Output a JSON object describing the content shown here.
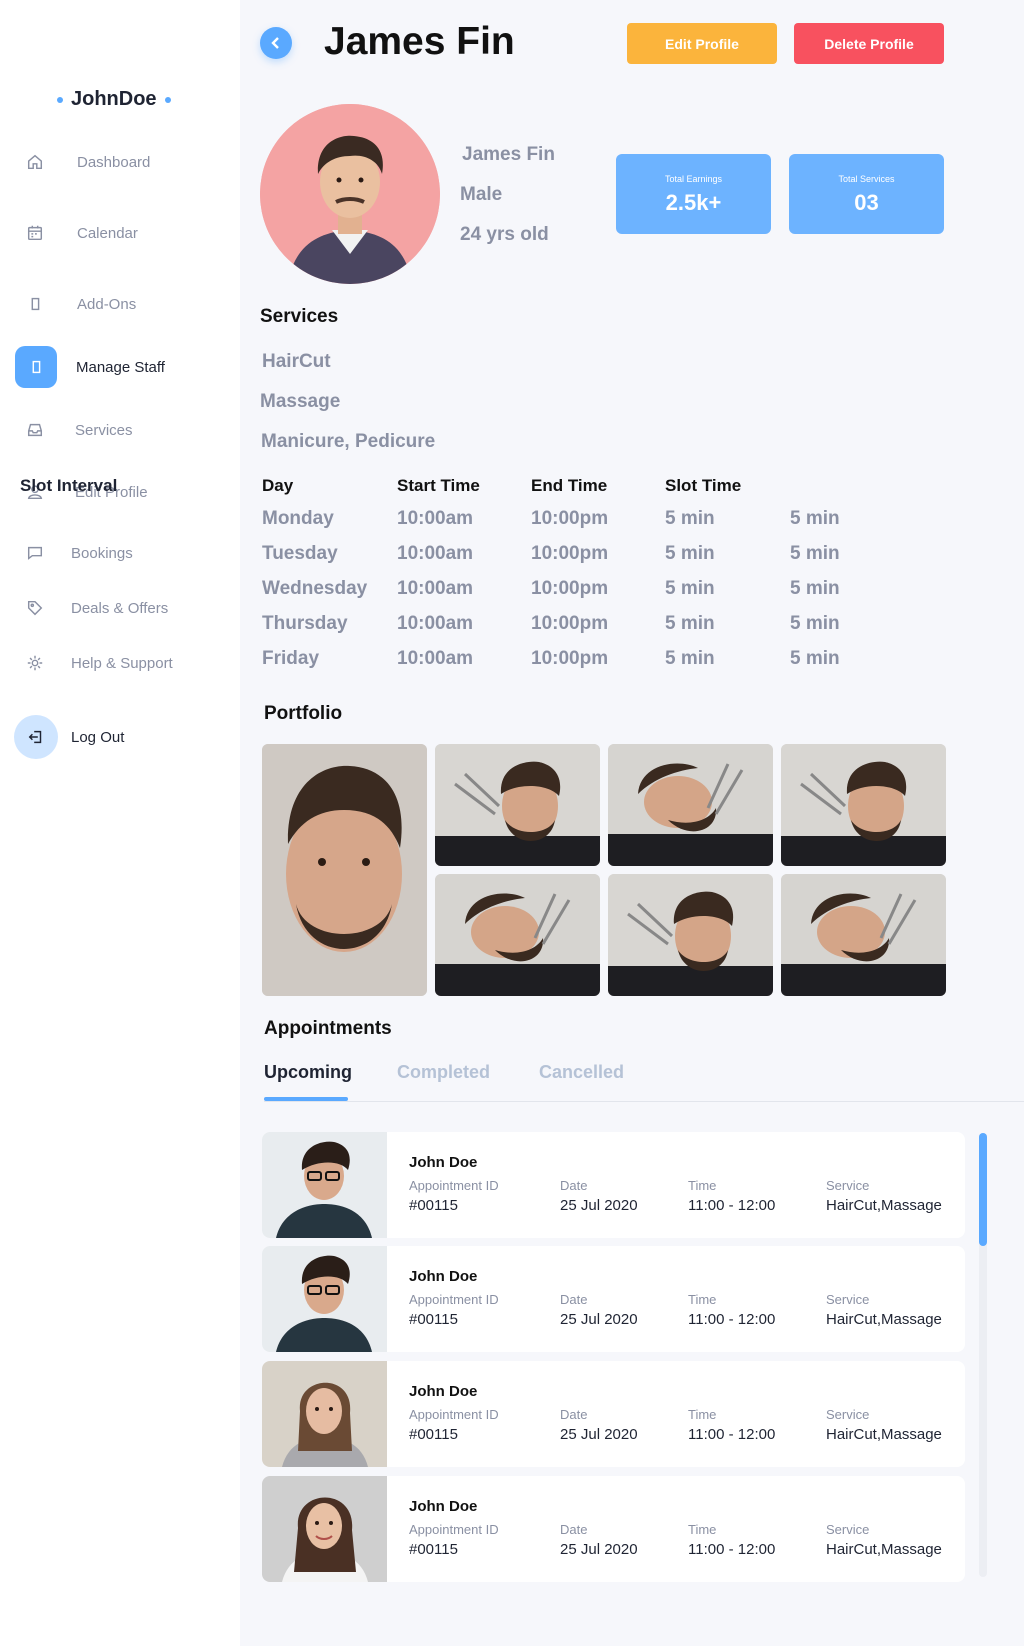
{
  "sidebar": {
    "brand": "JohnDoe",
    "items": [
      {
        "label": "Dashboard",
        "icon": "home-icon"
      },
      {
        "label": "Calendar",
        "icon": "calendar-icon"
      },
      {
        "label": "Add-Ons",
        "icon": "square-icon"
      },
      {
        "label": "Manage Staff",
        "icon": "square-icon"
      },
      {
        "label": "Services",
        "icon": "inbox-icon"
      },
      {
        "label": "Edit Profile",
        "icon": "user-icon"
      },
      {
        "label": "Bookings",
        "icon": "chat-icon"
      },
      {
        "label": "Deals & Offers",
        "icon": "tag-icon"
      },
      {
        "label": "Help & Support",
        "icon": "gear-icon"
      },
      {
        "label": "Log Out",
        "icon": "logout-icon"
      }
    ],
    "active_item": "Manage Staff",
    "overlay_label": "Slot Interval"
  },
  "header": {
    "title": "James Fin",
    "edit_label": "Edit Profile",
    "delete_label": "Delete Profile"
  },
  "profile": {
    "name": "James Fin",
    "gender": "Male",
    "age": "24 yrs old",
    "stats": [
      {
        "label": "Total Earnings",
        "value": "2.5k+"
      },
      {
        "label": "Total Services",
        "value": "03"
      }
    ]
  },
  "services": {
    "title": "Services",
    "items": [
      "HairCut",
      "Massage",
      "Manicure, Pedicure"
    ]
  },
  "schedule": {
    "headers": [
      "Day",
      "Start Time",
      "End Time",
      "Slot Time"
    ],
    "rows": [
      [
        "Monday",
        "10:00am",
        "10:00pm",
        "5 min",
        "5 min"
      ],
      [
        "Tuesday",
        "10:00am",
        "10:00pm",
        "5 min",
        "5 min"
      ],
      [
        "Wednesday",
        "10:00am",
        "10:00pm",
        "5 min",
        "5 min"
      ],
      [
        "Thursday",
        "10:00am",
        "10:00pm",
        "5 min",
        "5 min"
      ],
      [
        "Friday",
        "10:00am",
        "10:00pm",
        "5 min",
        "5 min"
      ]
    ]
  },
  "portfolio": {
    "title": "Portfolio"
  },
  "appointments": {
    "title": "Appointments",
    "tabs": [
      "Upcoming",
      "Completed",
      "Cancelled"
    ],
    "active_tab": "Upcoming",
    "labels": {
      "id": "Appointment ID",
      "date": "Date",
      "time": "Time",
      "service": "Service"
    },
    "items": [
      {
        "name": "John Doe",
        "id": "#00115",
        "date": "25 Jul 2020",
        "time": "11:00 - 12:00",
        "service": "HairCut,Massage"
      },
      {
        "name": "John Doe",
        "id": "#00115",
        "date": "25 Jul 2020",
        "time": "11:00 - 12:00",
        "service": "HairCut,Massage"
      },
      {
        "name": "John Doe",
        "id": "#00115",
        "date": "25 Jul 2020",
        "time": "11:00 - 12:00",
        "service": "HairCut,Massage"
      },
      {
        "name": "John Doe",
        "id": "#00115",
        "date": "25 Jul 2020",
        "time": "11:00 - 12:00",
        "service": "HairCut,Massage"
      }
    ]
  },
  "colors": {
    "accent": "#5aa9ff",
    "edit": "#fbb43c",
    "delete": "#f8515f",
    "muted_text": "#8a90a3"
  }
}
